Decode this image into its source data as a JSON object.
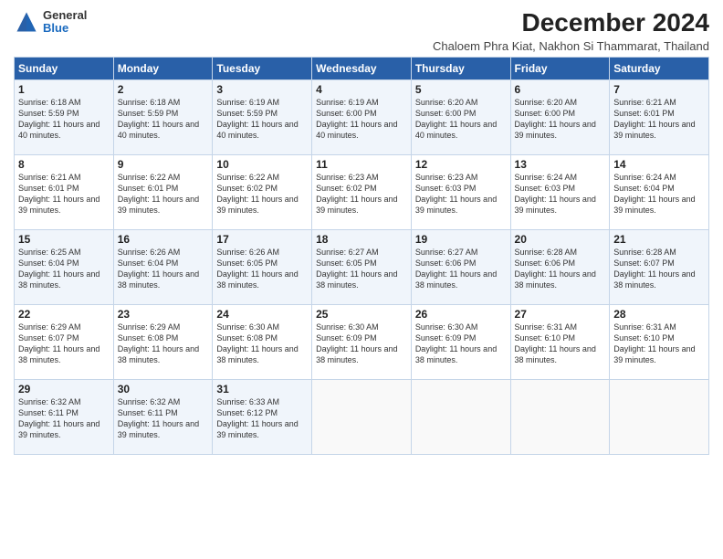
{
  "header": {
    "logo_general": "General",
    "logo_blue": "Blue",
    "main_title": "December 2024",
    "subtitle": "Chaloem Phra Kiat, Nakhon Si Thammarat, Thailand"
  },
  "columns": [
    "Sunday",
    "Monday",
    "Tuesday",
    "Wednesday",
    "Thursday",
    "Friday",
    "Saturday"
  ],
  "weeks": [
    [
      {
        "day": "1",
        "sunrise": "6:18 AM",
        "sunset": "5:59 PM",
        "daylight": "11 hours and 40 minutes."
      },
      {
        "day": "2",
        "sunrise": "6:18 AM",
        "sunset": "5:59 PM",
        "daylight": "11 hours and 40 minutes."
      },
      {
        "day": "3",
        "sunrise": "6:19 AM",
        "sunset": "5:59 PM",
        "daylight": "11 hours and 40 minutes."
      },
      {
        "day": "4",
        "sunrise": "6:19 AM",
        "sunset": "6:00 PM",
        "daylight": "11 hours and 40 minutes."
      },
      {
        "day": "5",
        "sunrise": "6:20 AM",
        "sunset": "6:00 PM",
        "daylight": "11 hours and 40 minutes."
      },
      {
        "day": "6",
        "sunrise": "6:20 AM",
        "sunset": "6:00 PM",
        "daylight": "11 hours and 39 minutes."
      },
      {
        "day": "7",
        "sunrise": "6:21 AM",
        "sunset": "6:01 PM",
        "daylight": "11 hours and 39 minutes."
      }
    ],
    [
      {
        "day": "8",
        "sunrise": "6:21 AM",
        "sunset": "6:01 PM",
        "daylight": "11 hours and 39 minutes."
      },
      {
        "day": "9",
        "sunrise": "6:22 AM",
        "sunset": "6:01 PM",
        "daylight": "11 hours and 39 minutes."
      },
      {
        "day": "10",
        "sunrise": "6:22 AM",
        "sunset": "6:02 PM",
        "daylight": "11 hours and 39 minutes."
      },
      {
        "day": "11",
        "sunrise": "6:23 AM",
        "sunset": "6:02 PM",
        "daylight": "11 hours and 39 minutes."
      },
      {
        "day": "12",
        "sunrise": "6:23 AM",
        "sunset": "6:03 PM",
        "daylight": "11 hours and 39 minutes."
      },
      {
        "day": "13",
        "sunrise": "6:24 AM",
        "sunset": "6:03 PM",
        "daylight": "11 hours and 39 minutes."
      },
      {
        "day": "14",
        "sunrise": "6:24 AM",
        "sunset": "6:04 PM",
        "daylight": "11 hours and 39 minutes."
      }
    ],
    [
      {
        "day": "15",
        "sunrise": "6:25 AM",
        "sunset": "6:04 PM",
        "daylight": "11 hours and 38 minutes."
      },
      {
        "day": "16",
        "sunrise": "6:26 AM",
        "sunset": "6:04 PM",
        "daylight": "11 hours and 38 minutes."
      },
      {
        "day": "17",
        "sunrise": "6:26 AM",
        "sunset": "6:05 PM",
        "daylight": "11 hours and 38 minutes."
      },
      {
        "day": "18",
        "sunrise": "6:27 AM",
        "sunset": "6:05 PM",
        "daylight": "11 hours and 38 minutes."
      },
      {
        "day": "19",
        "sunrise": "6:27 AM",
        "sunset": "6:06 PM",
        "daylight": "11 hours and 38 minutes."
      },
      {
        "day": "20",
        "sunrise": "6:28 AM",
        "sunset": "6:06 PM",
        "daylight": "11 hours and 38 minutes."
      },
      {
        "day": "21",
        "sunrise": "6:28 AM",
        "sunset": "6:07 PM",
        "daylight": "11 hours and 38 minutes."
      }
    ],
    [
      {
        "day": "22",
        "sunrise": "6:29 AM",
        "sunset": "6:07 PM",
        "daylight": "11 hours and 38 minutes."
      },
      {
        "day": "23",
        "sunrise": "6:29 AM",
        "sunset": "6:08 PM",
        "daylight": "11 hours and 38 minutes."
      },
      {
        "day": "24",
        "sunrise": "6:30 AM",
        "sunset": "6:08 PM",
        "daylight": "11 hours and 38 minutes."
      },
      {
        "day": "25",
        "sunrise": "6:30 AM",
        "sunset": "6:09 PM",
        "daylight": "11 hours and 38 minutes."
      },
      {
        "day": "26",
        "sunrise": "6:30 AM",
        "sunset": "6:09 PM",
        "daylight": "11 hours and 38 minutes."
      },
      {
        "day": "27",
        "sunrise": "6:31 AM",
        "sunset": "6:10 PM",
        "daylight": "11 hours and 38 minutes."
      },
      {
        "day": "28",
        "sunrise": "6:31 AM",
        "sunset": "6:10 PM",
        "daylight": "11 hours and 39 minutes."
      }
    ],
    [
      {
        "day": "29",
        "sunrise": "6:32 AM",
        "sunset": "6:11 PM",
        "daylight": "11 hours and 39 minutes."
      },
      {
        "day": "30",
        "sunrise": "6:32 AM",
        "sunset": "6:11 PM",
        "daylight": "11 hours and 39 minutes."
      },
      {
        "day": "31",
        "sunrise": "6:33 AM",
        "sunset": "6:12 PM",
        "daylight": "11 hours and 39 minutes."
      },
      null,
      null,
      null,
      null
    ]
  ]
}
